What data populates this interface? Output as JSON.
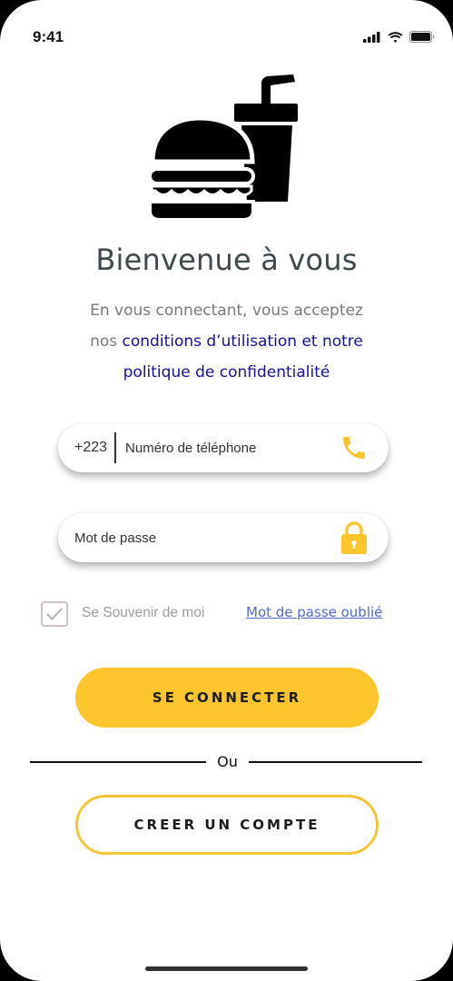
{
  "status_bar": {
    "time": "9:41",
    "icons": [
      "signal-icon",
      "wifi-icon",
      "battery-icon"
    ]
  },
  "logo": {
    "icon": "burger-drink-icon"
  },
  "welcome": {
    "title": "Bienvenue à vous",
    "line1": "En vous connectant, vous acceptez",
    "line2_prefix": "nos ",
    "line2_link": "conditions d’utilisation et notre",
    "line3_link": "politique de confidentialité"
  },
  "form": {
    "phone_prefix": "+223",
    "phone_placeholder": "Numéro de téléphone",
    "phone_icon": "phone-icon",
    "password_placeholder": "Mot de passe",
    "password_icon": "lock-icon",
    "remember_label": "Se Souvenir de moi",
    "remember_checked": true,
    "forgot_label": "Mot de passe oublié"
  },
  "actions": {
    "login_label": "SE CONNECTER",
    "or_label": "Ou",
    "register_label": "CREER UN COMPTE"
  },
  "colors": {
    "accent": "#fcc52b",
    "link": "#14109e",
    "forgot_link": "#4f6bd8",
    "title": "#3f4a4e"
  }
}
